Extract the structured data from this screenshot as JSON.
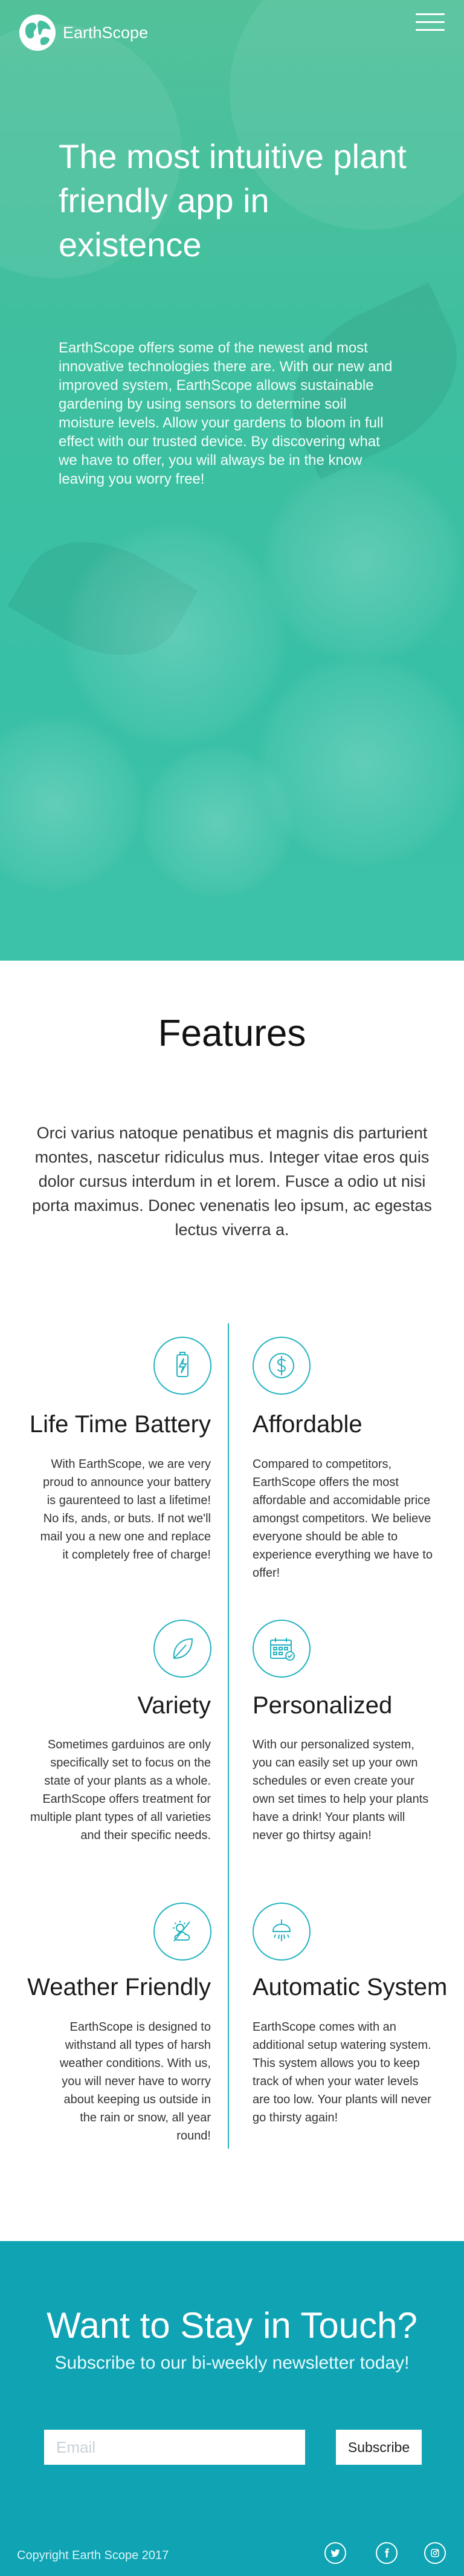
{
  "brand": {
    "name": "EarthScope"
  },
  "hero": {
    "title": "The most intuitive plant friendly app in existence",
    "description": "EarthScope offers some of the newest and most innovative technologies there are. With our new and improved system, EarthScope allows sustainable gardening by using sensors to determine soil moisture levels. Allow your gardens to bloom in full effect with our trusted device. By discovering what we have to offer, you will always be in the know leaving you worry free!"
  },
  "features": {
    "title": "Features",
    "intro": "Orci varius natoque penatibus et magnis dis parturient montes, nascetur ridiculus mus. Integer vitae eros quis dolor cursus interdum in et lorem. Fusce a odio ut nisi porta maximus. Donec venenatis leo ipsum, ac egestas lectus viverra a.",
    "items": [
      {
        "icon": "battery-icon",
        "title": "Life Time Battery",
        "text": "With EarthScope, we are very proud to announce your battery is gaurenteed to last a lifetime! No ifs, ands, or buts. If not we'll mail you a new one and replace it completely free of charge!"
      },
      {
        "icon": "dollar-icon",
        "title": "Affordable",
        "text": "Compared to competitors, EarthScope offers the most affordable and accomidable price amongst competitors. We believe everyone should be able to experience everything we have to offer!"
      },
      {
        "icon": "leaf-icon",
        "title": "Variety",
        "text": "Sometimes garduinos are only specifically set to focus on the state of your plants as a whole. EarthScope offers treatment for multiple plant types of all varieties and their specific needs."
      },
      {
        "icon": "calendar-icon",
        "title": "Personalized",
        "text": "With our personalized system, you can easily set up your own schedules or even create your own set times to help your plants have a drink! Your plants will never go thirtsy again!"
      },
      {
        "icon": "weather-icon",
        "title": "Weather Friendly",
        "text": "EarthScope is designed to withstand all types of harsh weather conditions. With us, you will never have to worry about keeping us outside in the rain or snow, all year round!"
      },
      {
        "icon": "sprinkler-icon",
        "title": "Automatic System",
        "text": "EarthScope comes with an additional setup watering system. This system allows you to keep track of when your water levels are too low. Your plants will never go thirsty again!"
      }
    ]
  },
  "newsletter": {
    "title": "Want to Stay in Touch?",
    "subtitle": "Subscribe to our bi-weekly newsletter today!",
    "email_placeholder": "Email",
    "subscribe_label": "Subscribe"
  },
  "footer": {
    "copyright": "Copyright Earth Scope 2017",
    "social": [
      "twitter-icon",
      "facebook-icon",
      "instagram-icon"
    ]
  },
  "colors": {
    "hero_teal": "#3fbf9f",
    "accent": "#24b3c0",
    "newsletter_bg": "#0fa3b3"
  }
}
